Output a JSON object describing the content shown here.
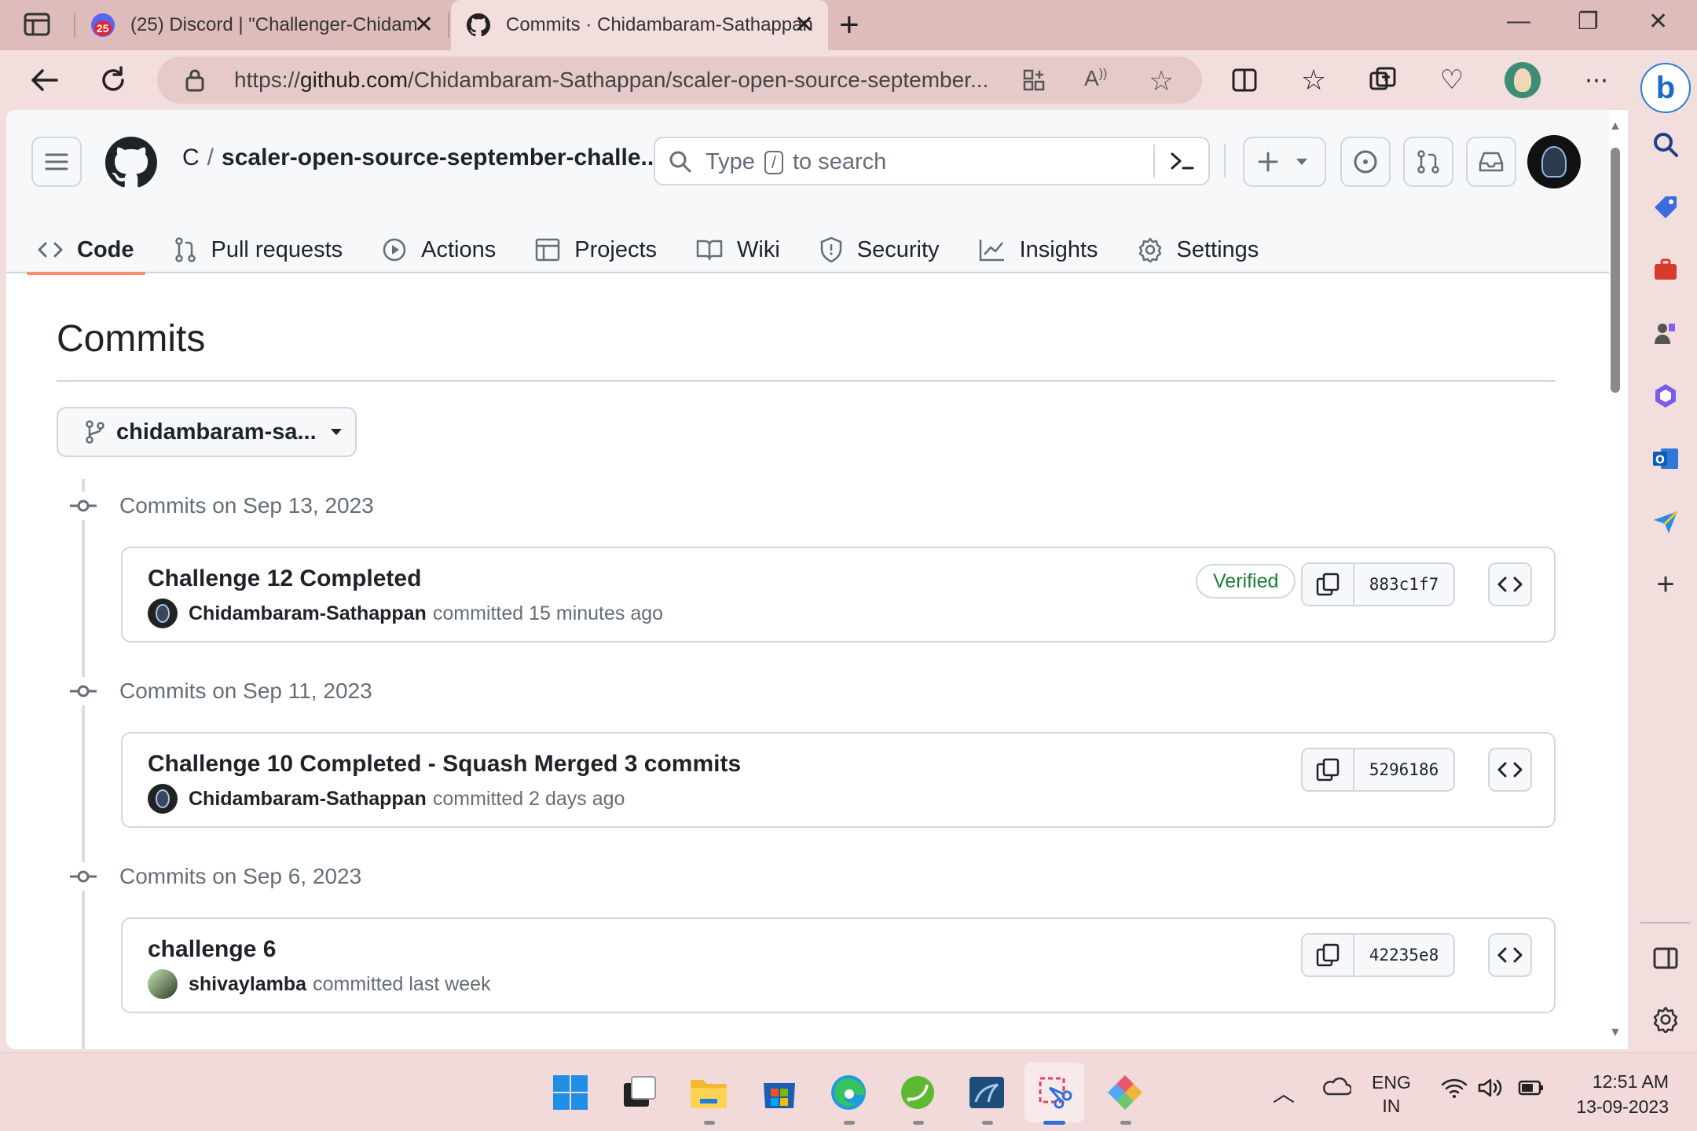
{
  "browser": {
    "tabs": [
      {
        "title": "(25) Discord | \"Challenger-Chidam",
        "badge": "25",
        "active": false
      },
      {
        "title": "Commits · Chidambaram-Sathappan",
        "active": true
      }
    ],
    "url_prefix": "https://",
    "url_host": "github.com",
    "url_path": "/Chidambaram-Sathappan/scaler-open-source-september..."
  },
  "github": {
    "repo_owner": "C",
    "repo_name": "scaler-open-source-september-challe...",
    "search": {
      "prefix": "Type",
      "key": "/",
      "suffix": "to search"
    },
    "nav": [
      {
        "label": "Code",
        "icon": "code-icon",
        "active": true
      },
      {
        "label": "Pull requests",
        "icon": "pull-request-icon"
      },
      {
        "label": "Actions",
        "icon": "play-icon"
      },
      {
        "label": "Projects",
        "icon": "table-icon"
      },
      {
        "label": "Wiki",
        "icon": "book-icon"
      },
      {
        "label": "Security",
        "icon": "shield-icon"
      },
      {
        "label": "Insights",
        "icon": "graph-icon"
      },
      {
        "label": "Settings",
        "icon": "gear-icon"
      }
    ],
    "page_title": "Commits",
    "branch": "chidambaram-sa...",
    "groups": [
      {
        "header": "Commits on Sep 13, 2023",
        "commit": {
          "message": "Challenge 12 Completed",
          "author": "Chidambaram-Sathappan",
          "action": "committed",
          "time": "15 minutes ago",
          "verified": "Verified",
          "sha": "883c1f7"
        }
      },
      {
        "header": "Commits on Sep 11, 2023",
        "commit": {
          "message": "Challenge 10 Completed - Squash Merged 3 commits",
          "author": "Chidambaram-Sathappan",
          "action": "committed",
          "time": "2 days ago",
          "sha": "5296186"
        }
      },
      {
        "header": "Commits on Sep 6, 2023",
        "commit": {
          "message": "challenge 6",
          "author": "shivaylamba",
          "action": "committed",
          "time": "last week",
          "sha": "42235e8"
        }
      }
    ]
  },
  "taskbar": {
    "lang_top": "ENG",
    "lang_bottom": "IN",
    "time": "12:51 AM",
    "date": "13-09-2023"
  },
  "colors": {
    "accent_underline": "#fd8c73",
    "verified_green": "#1a7f37",
    "chrome_bg": "#f3dede"
  }
}
